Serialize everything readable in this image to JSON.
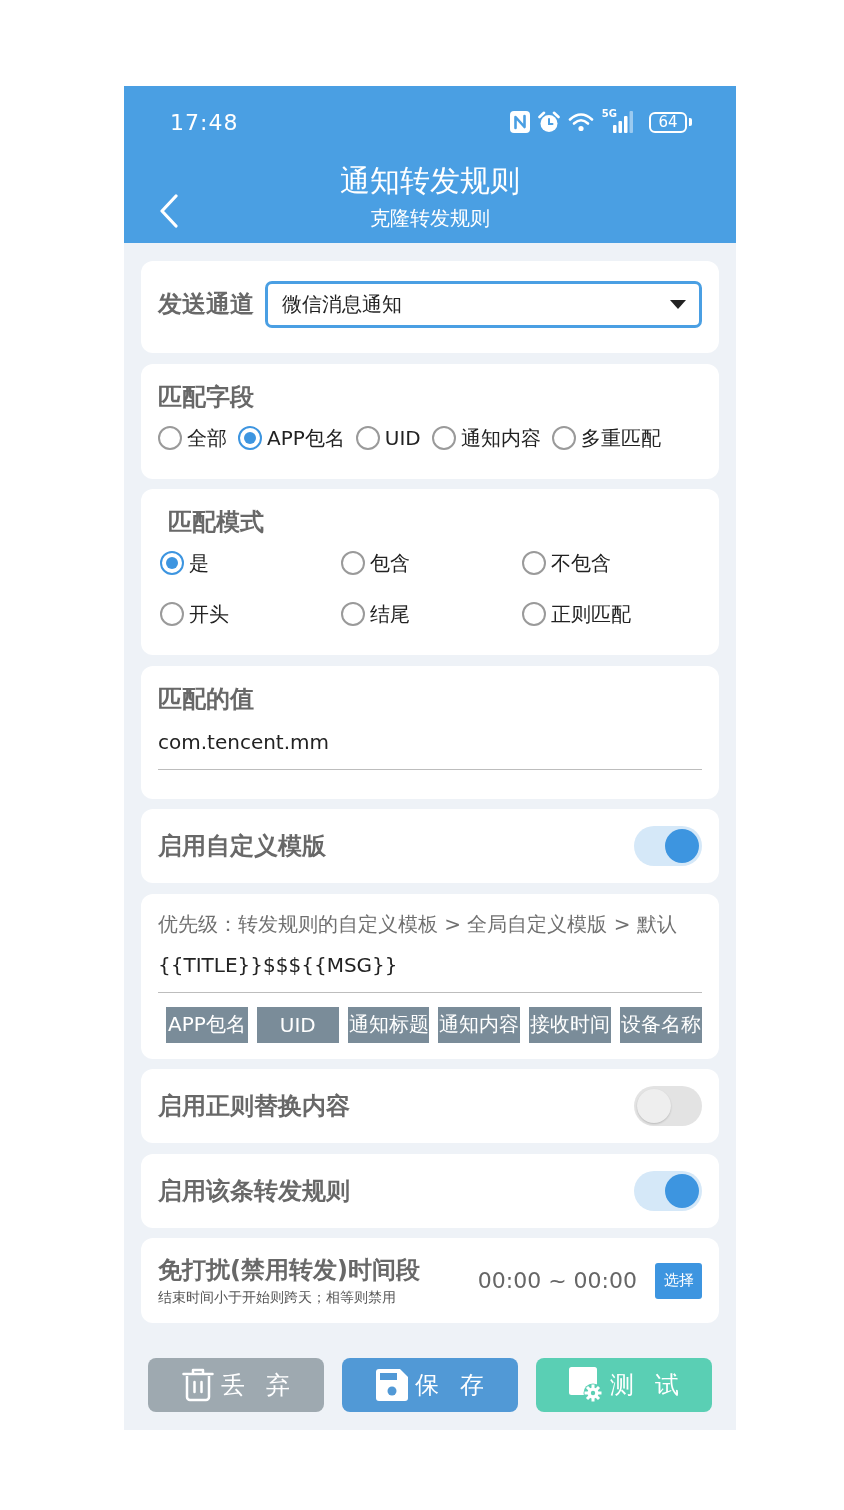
{
  "status_bar": {
    "time": "17:48",
    "network": "5G",
    "battery": "64"
  },
  "header": {
    "title": "通知转发规则",
    "subtitle": "克隆转发规则"
  },
  "channel": {
    "label": "发送通道",
    "value": "微信消息通知"
  },
  "match_field": {
    "label": "匹配字段",
    "options": [
      {
        "label": "全部",
        "selected": false
      },
      {
        "label": "APP包名",
        "selected": true
      },
      {
        "label": "UID",
        "selected": false
      },
      {
        "label": "通知内容",
        "selected": false
      },
      {
        "label": "多重匹配",
        "selected": false
      }
    ]
  },
  "match_mode": {
    "label": "匹配模式",
    "options": [
      {
        "label": "是",
        "selected": true
      },
      {
        "label": "包含",
        "selected": false
      },
      {
        "label": "不包含",
        "selected": false
      },
      {
        "label": "开头",
        "selected": false
      },
      {
        "label": "结尾",
        "selected": false
      },
      {
        "label": "正则匹配",
        "selected": false
      }
    ]
  },
  "match_value": {
    "label": "匹配的值",
    "value": "com.tencent.mm"
  },
  "custom_template": {
    "label": "启用自定义模版",
    "on": true
  },
  "template": {
    "hint": "优先级：转发规则的自定义模板 > 全局自定义模版 > 默认",
    "value": "{{TITLE}}$$${{MSG}}",
    "tags": [
      "APP包名",
      "UID",
      "通知标题",
      "通知内容",
      "接收时间",
      "设备名称"
    ]
  },
  "regex_replace": {
    "label": "启用正则替换内容",
    "on": false
  },
  "rule_enabled": {
    "label": "启用该条转发规则",
    "on": true
  },
  "quiet_hours": {
    "title": "免打扰(禁用转发)时间段",
    "note": "结束时间小于开始则跨天；相等则禁用",
    "range": "00:00 ~ 00:00",
    "button": "选择"
  },
  "actions": [
    {
      "kind": "discard",
      "label": "丢 弃"
    },
    {
      "kind": "save",
      "label": "保 存"
    },
    {
      "kind": "test",
      "label": "测 试"
    }
  ]
}
